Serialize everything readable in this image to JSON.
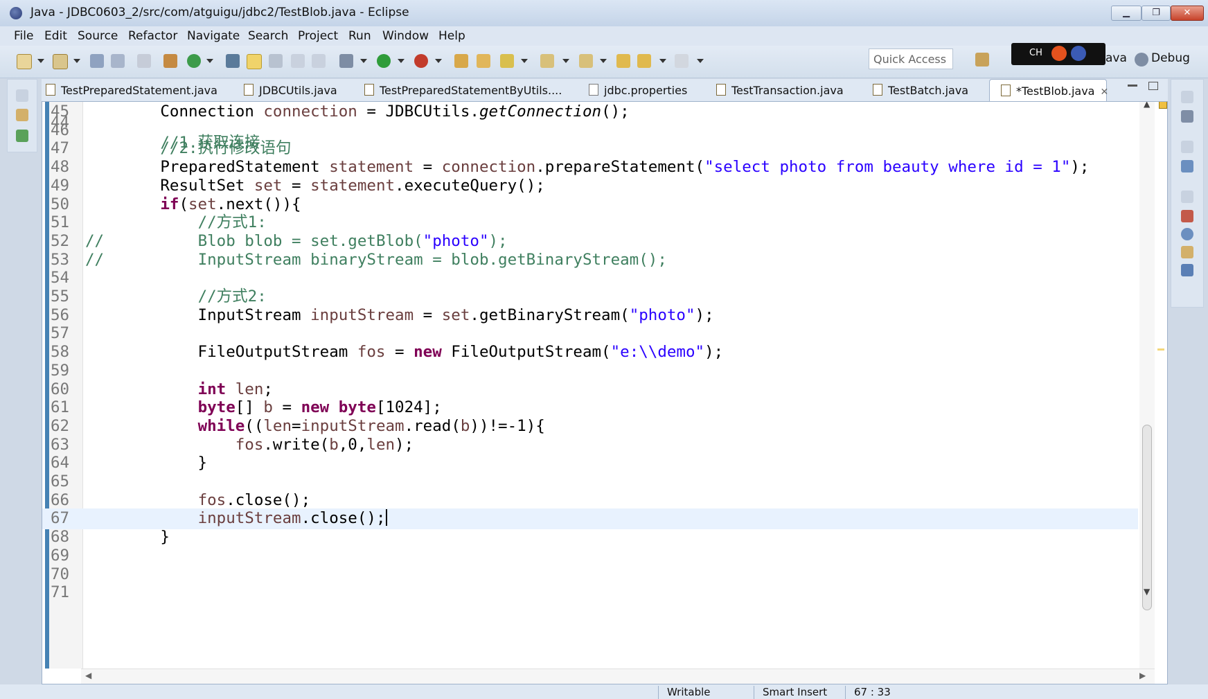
{
  "window": {
    "title": "Java - JDBC0603_2/src/com/atguigu/jdbc2/TestBlob.java - Eclipse",
    "minimize": "▁",
    "maximize": "❐",
    "close": "✕"
  },
  "menu": [
    "File",
    "Edit",
    "Source",
    "Refactor",
    "Navigate",
    "Search",
    "Project",
    "Run",
    "Window",
    "Help"
  ],
  "toolbar": {
    "quick_access_placeholder": "Quick Access",
    "perspective_java": "ava",
    "perspective_debug": "Debug",
    "ime_label": "CH"
  },
  "tabs": [
    {
      "label": "TestPreparedStatement.java",
      "active": false
    },
    {
      "label": "JDBCUtils.java",
      "active": false
    },
    {
      "label": "TestPreparedStatementByUtils....",
      "active": false
    },
    {
      "label": "jdbc.properties",
      "active": false
    },
    {
      "label": "TestTransaction.java",
      "active": false
    },
    {
      "label": "TestBatch.java",
      "active": false
    },
    {
      "label": "*TestBlob.java",
      "active": true
    }
  ],
  "editor": {
    "first_partial_line": "44",
    "lines": [
      {
        "n": "45",
        "code": "        Connection connection = JDBCUtils.getConnection();"
      },
      {
        "n": "46",
        "code": ""
      },
      {
        "n": "47",
        "code": "        //2.执行修改语句"
      },
      {
        "n": "48",
        "code": "        PreparedStatement statement = connection.prepareStatement(\"select photo from beauty where id = 1\");"
      },
      {
        "n": "49",
        "code": "        ResultSet set = statement.executeQuery();"
      },
      {
        "n": "50",
        "code": "        if(set.next()){"
      },
      {
        "n": "51",
        "code": "            //方式1:"
      },
      {
        "n": "52",
        "code": "//          Blob blob = set.getBlob(\"photo\");"
      },
      {
        "n": "53",
        "code": "//          InputStream binaryStream = blob.getBinaryStream();"
      },
      {
        "n": "54",
        "code": ""
      },
      {
        "n": "55",
        "code": "            //方式2:"
      },
      {
        "n": "56",
        "code": "            InputStream inputStream = set.getBinaryStream(\"photo\");"
      },
      {
        "n": "57",
        "code": ""
      },
      {
        "n": "58",
        "code": "            FileOutputStream fos = new FileOutputStream(\"e:\\\\demo\");"
      },
      {
        "n": "59",
        "code": ""
      },
      {
        "n": "60",
        "code": "            int len;"
      },
      {
        "n": "61",
        "code": "            byte[] b = new byte[1024];"
      },
      {
        "n": "62",
        "code": "            while((len=inputStream.read(b))!=-1){"
      },
      {
        "n": "63",
        "code": "                fos.write(b,0,len);"
      },
      {
        "n": "64",
        "code": "            }"
      },
      {
        "n": "65",
        "code": ""
      },
      {
        "n": "66",
        "code": "            fos.close();"
      },
      {
        "n": "67",
        "code": "            inputStream.close();"
      },
      {
        "n": "68",
        "code": "        }"
      },
      {
        "n": "69",
        "code": ""
      },
      {
        "n": "70",
        "code": ""
      },
      {
        "n": "71",
        "code": ""
      }
    ],
    "current_line": "67"
  },
  "status": {
    "writable": "Writable",
    "insert_mode": "Smart Insert",
    "position": "67 : 33"
  },
  "colors": {
    "keyword": "#7f0055",
    "comment": "#3f7f5f",
    "string": "#2a00ff",
    "local_variable": "#6a3e3e",
    "current_line_bg": "#e8f2fe"
  }
}
